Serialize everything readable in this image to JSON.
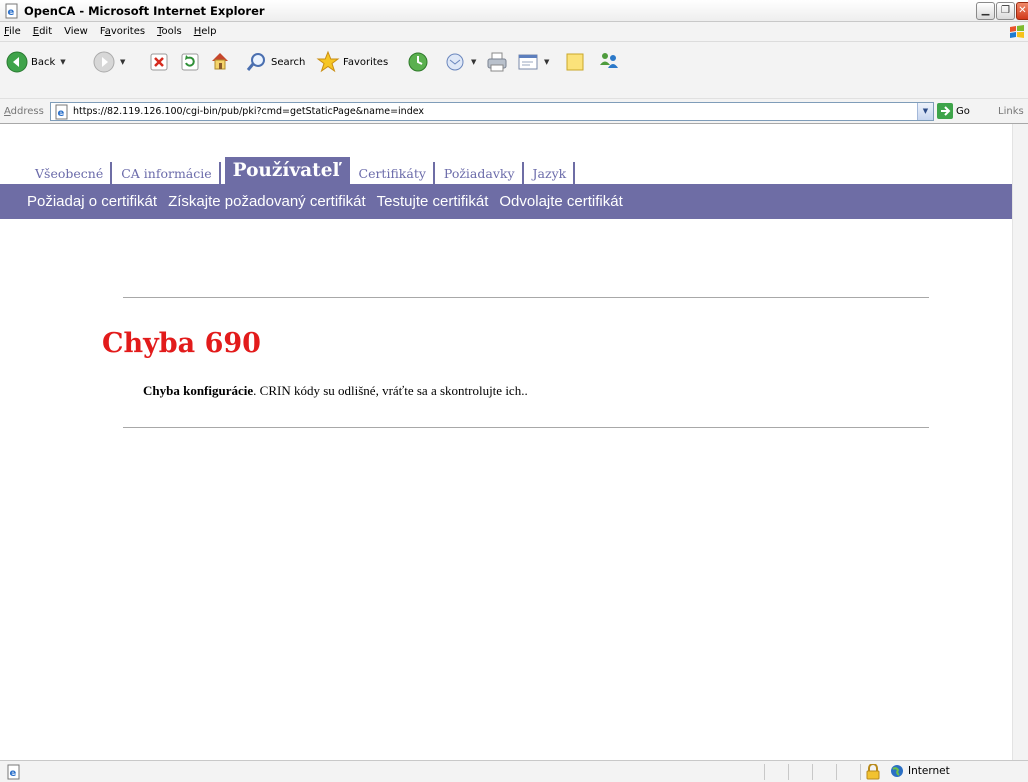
{
  "window": {
    "title": "OpenCA - Microsoft Internet Explorer"
  },
  "menu": {
    "items": [
      {
        "first": "F",
        "rest": "ile"
      },
      {
        "first": "E",
        "rest": "dit"
      },
      {
        "first": "V",
        "rest": "iew"
      },
      {
        "first": "F",
        "rest": "avorites",
        "pre": "F",
        "label": "Favorites"
      },
      {
        "first": "T",
        "rest": "ools"
      },
      {
        "first": "H",
        "rest": "elp"
      }
    ]
  },
  "toolbar": {
    "back_label": "Back",
    "search_label": "Search",
    "favorites_label": "Favorites"
  },
  "address": {
    "label_first": "A",
    "label_rest": "ddress",
    "url": "https://82.119.126.100/cgi-bin/pub/pki?cmd=getStaticPage&name=index",
    "go_label": "Go",
    "links_label": "Links"
  },
  "tabs": [
    {
      "label": "Všeobecné",
      "active": false
    },
    {
      "label": "CA informácie",
      "active": false
    },
    {
      "label": "Používateľ",
      "active": true
    },
    {
      "label": "Certifikáty",
      "active": false
    },
    {
      "label": "Požiadavky",
      "active": false
    },
    {
      "label": "Jazyk",
      "active": false
    }
  ],
  "subnav": [
    "Požiadaj o certifikát",
    "Získajte požadovaný certifikát",
    "Testujte certifikát",
    "Odvolajte certifikát"
  ],
  "error": {
    "title": "Chyba 690",
    "message_bold": "Chyba konfigurácie",
    "message_rest": ". CRIN kódy su odlišné, vráťte sa a skontrolujte ich.."
  },
  "status": {
    "zone": "Internet"
  },
  "colors": {
    "nav_purple": "#6e6da5",
    "error_red": "#e21b1b"
  }
}
